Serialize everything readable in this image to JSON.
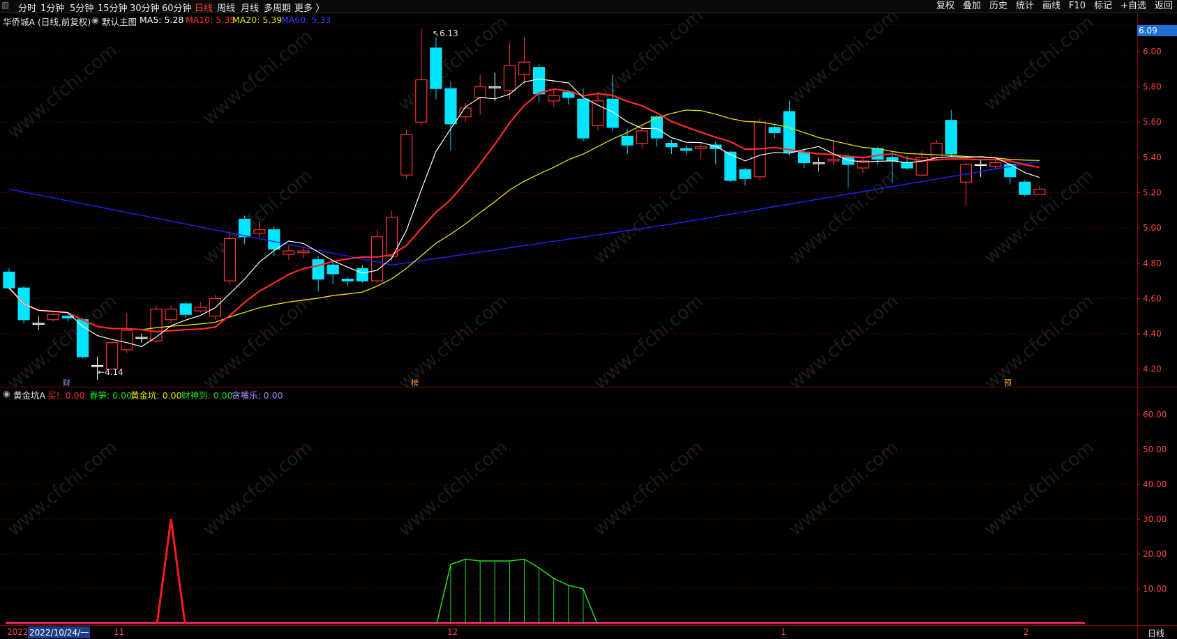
{
  "topbar": {
    "periods": [
      "分时",
      "1分钟",
      "5分钟",
      "15分钟",
      "30分钟",
      "60分钟",
      "日线",
      "周线",
      "月线",
      "多周期",
      "更多 〉"
    ],
    "active_index": 6,
    "right_buttons": [
      "复权",
      "叠加",
      "历史",
      "统计",
      "画线",
      "F10",
      "标记",
      "+自选",
      "返回"
    ]
  },
  "main_header": {
    "stock": "华侨城A (日线,前复权)",
    "indicator": "默认主图",
    "ma5": "MA5: 5.28",
    "ma10": "MA10: 5.35",
    "ma20": "MA20: 5.39",
    "ma60": "MA60: 5.33"
  },
  "price_axis": {
    "current": "6.09",
    "ticks": [
      "6.00",
      "5.80",
      "5.60",
      "5.40",
      "5.20",
      "5.00",
      "4.80",
      "4.60",
      "4.40",
      "4.20"
    ]
  },
  "annotations": {
    "high": "6.13",
    "low": "4.14",
    "event_cai": "财",
    "event_bang": "榜",
    "event_yu": "预"
  },
  "sub_header": {
    "name": "黄金坑A",
    "items": [
      "买!: 0.00",
      "春笋: 0.00",
      "黄金坑: 0.00",
      "财神到: 0.00",
      "贪嘴乐: 0.00"
    ]
  },
  "sub_axis": {
    "ticks": [
      "60.00",
      "50.00",
      "40.00",
      "30.00",
      "20.00",
      "10.00"
    ]
  },
  "date_axis": {
    "left_year": "2022",
    "current_date": "2022/10/24/一",
    "marks": [
      "11",
      "12",
      "1",
      "2"
    ],
    "period": "日线"
  },
  "watermark": "www.cfchi.com",
  "colors": {
    "up": "#ff3232",
    "down": "#00e5ff",
    "ma5": "#ffffff",
    "ma10": "#ff2a2a",
    "ma20": "#e6e600",
    "ma60": "#2222ff",
    "green": "#22dd22"
  },
  "chart_data": {
    "type": "candlestick",
    "ylim": [
      4.1,
      6.15
    ],
    "candles": [
      [
        4.75,
        4.66,
        4.77,
        4.65
      ],
      [
        4.66,
        4.48,
        4.67,
        4.46
      ],
      [
        4.46,
        4.46,
        4.5,
        4.42
      ],
      [
        4.48,
        4.51,
        4.52,
        4.47
      ],
      [
        4.5,
        4.49,
        4.52,
        4.47
      ],
      [
        4.48,
        4.27,
        4.49,
        4.26
      ],
      [
        4.22,
        4.22,
        4.27,
        4.14
      ],
      [
        4.2,
        4.35,
        4.36,
        4.2
      ],
      [
        4.31,
        4.42,
        4.52,
        4.29
      ],
      [
        4.38,
        4.38,
        4.4,
        4.35
      ],
      [
        4.36,
        4.54,
        4.56,
        4.35
      ],
      [
        4.48,
        4.54,
        4.56,
        4.46
      ],
      [
        4.57,
        4.51,
        4.58,
        4.49
      ],
      [
        4.53,
        4.55,
        4.58,
        4.52
      ],
      [
        4.5,
        4.6,
        4.62,
        4.48
      ],
      [
        4.7,
        4.94,
        4.98,
        4.68
      ],
      [
        5.05,
        4.95,
        5.07,
        4.91
      ],
      [
        4.97,
        4.99,
        5.04,
        4.95
      ],
      [
        4.99,
        4.88,
        5.01,
        4.84
      ],
      [
        4.85,
        4.87,
        4.9,
        4.82
      ],
      [
        4.86,
        4.87,
        4.89,
        4.83
      ],
      [
        4.82,
        4.71,
        4.84,
        4.64
      ],
      [
        4.79,
        4.74,
        4.81,
        4.68
      ],
      [
        4.71,
        4.7,
        4.72,
        4.67
      ],
      [
        4.77,
        4.7,
        4.79,
        4.69
      ],
      [
        4.7,
        4.95,
        4.99,
        4.69
      ],
      [
        4.84,
        5.06,
        5.1,
        4.81
      ],
      [
        5.3,
        5.53,
        5.56,
        5.28
      ],
      [
        5.6,
        5.84,
        6.13,
        5.58
      ],
      [
        6.02,
        5.79,
        6.08,
        5.73
      ],
      [
        5.79,
        5.59,
        5.83,
        5.44
      ],
      [
        5.63,
        5.68,
        5.71,
        5.6
      ],
      [
        5.74,
        5.8,
        5.87,
        5.64
      ],
      [
        5.8,
        5.8,
        5.88,
        5.72
      ],
      [
        5.78,
        5.92,
        6.05,
        5.73
      ],
      [
        5.87,
        5.94,
        6.08,
        5.82
      ],
      [
        5.91,
        5.76,
        5.93,
        5.71
      ],
      [
        5.72,
        5.75,
        5.79,
        5.69
      ],
      [
        5.77,
        5.74,
        5.78,
        5.7
      ],
      [
        5.73,
        5.51,
        5.79,
        5.49
      ],
      [
        5.58,
        5.72,
        5.77,
        5.55
      ],
      [
        5.73,
        5.57,
        5.87,
        5.55
      ],
      [
        5.52,
        5.47,
        5.56,
        5.42
      ],
      [
        5.48,
        5.55,
        5.58,
        5.45
      ],
      [
        5.63,
        5.51,
        5.64,
        5.46
      ],
      [
        5.48,
        5.46,
        5.5,
        5.42
      ],
      [
        5.45,
        5.44,
        5.47,
        5.41
      ],
      [
        5.45,
        5.46,
        5.48,
        5.39
      ],
      [
        5.47,
        5.45,
        5.49,
        5.36
      ],
      [
        5.43,
        5.27,
        5.44,
        5.26
      ],
      [
        5.33,
        5.28,
        5.34,
        5.24
      ],
      [
        5.29,
        5.6,
        5.62,
        5.27
      ],
      [
        5.57,
        5.54,
        5.59,
        5.51
      ],
      [
        5.66,
        5.43,
        5.72,
        5.41
      ],
      [
        5.43,
        5.37,
        5.45,
        5.34
      ],
      [
        5.37,
        5.37,
        5.4,
        5.32
      ],
      [
        5.38,
        5.39,
        5.49,
        5.36
      ],
      [
        5.4,
        5.36,
        5.42,
        5.23
      ],
      [
        5.34,
        5.38,
        5.4,
        5.31
      ],
      [
        5.45,
        5.39,
        5.46,
        5.36
      ],
      [
        5.4,
        5.38,
        5.43,
        5.26
      ],
      [
        5.37,
        5.34,
        5.41,
        5.33
      ],
      [
        5.3,
        5.4,
        5.44,
        5.29
      ],
      [
        5.4,
        5.48,
        5.5,
        5.39
      ],
      [
        5.61,
        5.42,
        5.67,
        5.4
      ],
      [
        5.26,
        5.36,
        5.37,
        5.12
      ],
      [
        5.36,
        5.36,
        5.39,
        5.29
      ],
      [
        5.35,
        5.37,
        5.39,
        5.33
      ],
      [
        5.36,
        5.29,
        5.37,
        5.25
      ],
      [
        5.26,
        5.19,
        5.27,
        5.18
      ],
      [
        5.19,
        5.22,
        5.24,
        5.19
      ]
    ],
    "sub_series": {
      "red_spike": {
        "index": 11,
        "value": 30
      },
      "green_bars": [
        17,
        18.5,
        18,
        18,
        18,
        18.5,
        16,
        13,
        11,
        10
      ]
    }
  }
}
